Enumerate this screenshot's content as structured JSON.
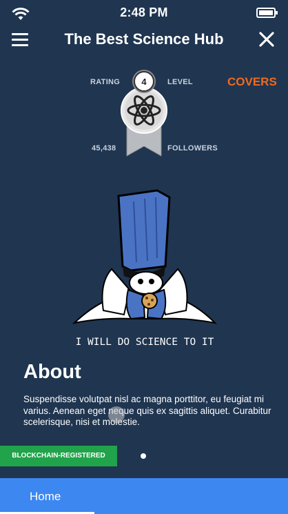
{
  "status_bar": {
    "time": "2:48 PM"
  },
  "header": {
    "title": "The Best Science Hub"
  },
  "profile": {
    "rating_label": "RATING",
    "level_label": "LEVEL",
    "level": "4",
    "followers_count": "45,438",
    "followers_label": "FOLLOWERS",
    "covers_label": "COVERS"
  },
  "hero": {
    "caption": "I WILL DO SCIENCE TO IT"
  },
  "about": {
    "heading": "About",
    "text": "Suspendisse volutpat nisl ac magna porttitor, eu feugiat mi varius. Aenean eget neque quis ex sagittis aliquet. Curabitur scelerisque, nisi et molestie."
  },
  "badge": {
    "label": "BLOCKCHAIN-REGISTERED"
  },
  "tabs": [
    {
      "label": "Home",
      "active": true
    }
  ],
  "colors": {
    "background": "#1f3550",
    "accent": "#f26a1b",
    "badge": "#20a34a",
    "tabbar": "#3d87f0"
  },
  "icons": [
    "wifi-icon",
    "battery-icon",
    "menu-icon",
    "close-icon",
    "atom-icon"
  ]
}
